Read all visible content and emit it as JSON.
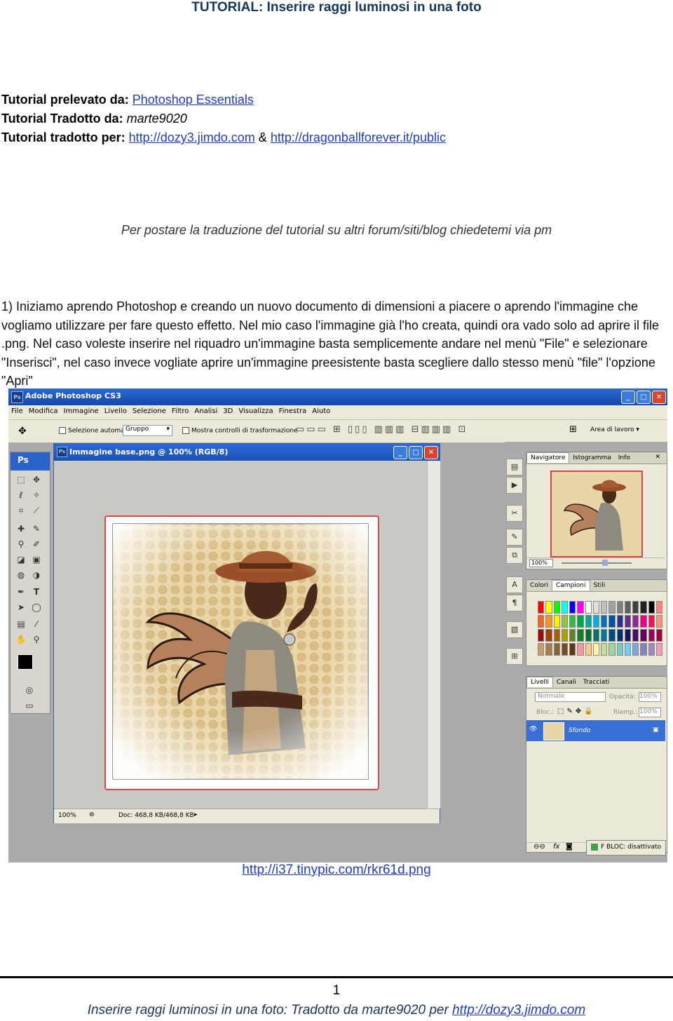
{
  "header": {
    "title": "TUTORIAL: Inserire raggi luminosi in una foto"
  },
  "credits": {
    "source_label": "Tutorial prelevato da:",
    "source_link": "Photoshop Essentials",
    "translator_label": "Tutorial Tradotto da:",
    "translator_name": "marte9020",
    "for_label": "Tutorial tradotto per:",
    "for_link1": "http://dozy3.jimdo.com",
    "for_sep": "&",
    "for_link2": "http://dragonballforever.it/public"
  },
  "notice": "Per postare la traduzione del tutorial su altri forum/siti/blog chiedetemi via pm",
  "step1": "1) Iniziamo aprendo Photoshop e creando un nuovo documento di dimensioni a piacere o aprendo l'immagine che vogliamo utilizzare per fare questo effetto. Nel mio caso l'immagine già l'ho creata, quindi ora vado solo ad aprire il file .png. Nel caso voleste inserire nel riquadro un'immagine basta semplicemente andare nel menù \"File\" e selezionare \"Inserisci\", nel caso invece vogliate aprire un'immagine preesistente basta scegliere dallo stesso menù \"file\" l'opzione \"Apri\"",
  "screenshot": {
    "app_title": "Adobe Photoshop CS3",
    "ps_logo": "Ps",
    "menu": [
      "File",
      "Modifica",
      "Immagine",
      "Livello",
      "Selezione",
      "Filtro",
      "Analisi",
      "3D",
      "Visualizza",
      "Finestra",
      "Aiuto"
    ],
    "options": {
      "auto_select": "Selezione automatica:",
      "group_value": "Gruppo",
      "transform": "Mostra controlli di trasformazione",
      "workspace": "Area di lavoro"
    },
    "document": {
      "title": "Immagine base.png @ 100% (RGB/8)",
      "zoom": "100%",
      "doc_info": "Doc: 468,8 KB/468,8 KB"
    },
    "panels": {
      "nav_tabs": [
        "Navigatore",
        "Istogramma",
        "Info"
      ],
      "nav_zoom": "100%",
      "color_tabs": [
        "Colori",
        "Campioni",
        "Stili"
      ],
      "layer_tabs": [
        "Livelli",
        "Canali",
        "Tracciati"
      ],
      "blend_mode": "Normale",
      "opacity_label": "Opacità:",
      "opacity_value": "100%",
      "lock_label": "Bloc.:",
      "fill_label": "Riemp.:",
      "fill_value": "100%",
      "layer_name": "Sfondo",
      "fbloc": "F BLOC: disattivato"
    },
    "colors": {
      "titlebar": "#1f56c0",
      "swatches": [
        "#ff0000",
        "#ffff00",
        "#00ff00",
        "#00ffff",
        "#0000ff",
        "#ff00ff",
        "#ffffff",
        "#e0e0e0",
        "#c0c0c0",
        "#a0a0a0",
        "#808080",
        "#606060",
        "#404040",
        "#202020",
        "#000000",
        "#ff8080",
        "#f26522",
        "#f7941d",
        "#fff200",
        "#8dc63f",
        "#39b54a",
        "#00a651",
        "#00a99d",
        "#00aeef",
        "#0072bc",
        "#0054a6",
        "#2e3192",
        "#662d91",
        "#92278f",
        "#ec008c",
        "#ed145b",
        "#f69679",
        "#9e0b0f",
        "#a0410d",
        "#a36209",
        "#aba000",
        "#598527",
        "#1a7b30",
        "#007236",
        "#00746b",
        "#0076a3",
        "#004b80",
        "#003471",
        "#1b1464",
        "#440e62",
        "#630460",
        "#9e005d",
        "#9e0039",
        "#c69c6d",
        "#a67c52",
        "#8c6239",
        "#754c24",
        "#603913",
        "#f5989d",
        "#fdc68a",
        "#fff799",
        "#c4df9b",
        "#a3d39c",
        "#7accc8",
        "#6dcff6",
        "#7da7d9",
        "#8781bd",
        "#a187be",
        "#f49ac1"
      ]
    }
  },
  "image_link": "http://i37.tinypic.com/rkr61d.png",
  "page_number": "1",
  "footer": {
    "text": "Inserire raggi luminosi in una foto: Tradotto da marte9020 per ",
    "link": "http://dozy3.jimdo.com"
  }
}
